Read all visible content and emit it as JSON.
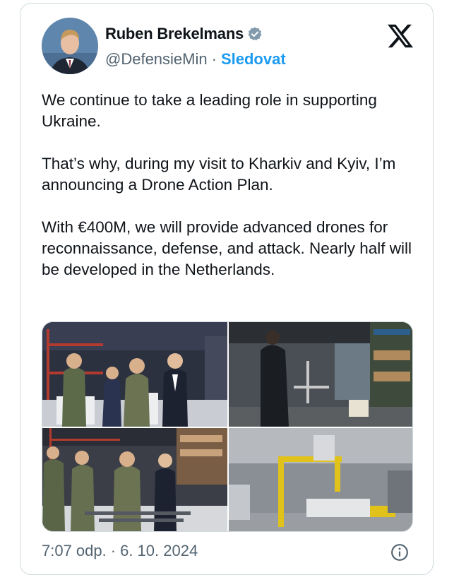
{
  "author": {
    "name": "Ruben Brekelmans",
    "handle": "@DefensieMin",
    "separator": "·",
    "follow_label": "Sledovat",
    "verified_icon": "verified-badge-icon",
    "avatar_icon": "avatar"
  },
  "platform_logo": "x-logo-icon",
  "tweet": {
    "paragraphs": [
      "We continue to take a leading role in supporting Ukraine.",
      "That’s why, during my visit to Kharkiv and Kyiv, I’m announcing a Drone Action Plan.",
      "With €400M, we will provide advanced drones for reconnaissance, defense, and attack. Nearly half will be developed in the Netherlands."
    ]
  },
  "footer": {
    "time": "7:07 odp.",
    "separator": "·",
    "date": "6. 10. 2024",
    "info_icon": "info-icon"
  },
  "colors": {
    "accent": "#1d9bf0",
    "text": "#0f1419",
    "muted": "#536471",
    "border": "#cfd9de"
  }
}
